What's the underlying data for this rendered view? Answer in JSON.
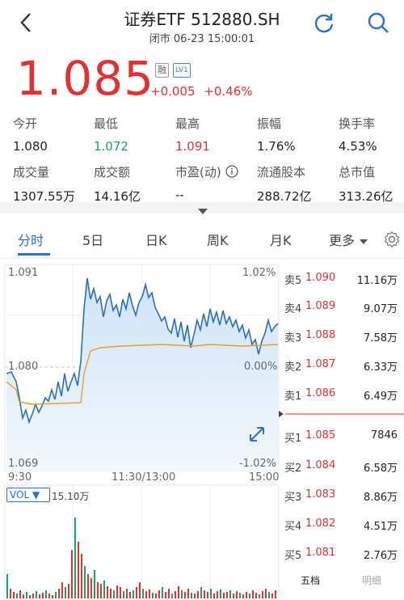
{
  "header": {
    "title": "证券ETF 512880.SH",
    "subtitle": "闭市 06-23 15:00:01"
  },
  "quote": {
    "price": "1.085",
    "tag_rong": "融",
    "tag_lv": "LV1",
    "change": "+0.005",
    "change_pct": "+0.46%"
  },
  "stats": {
    "open_label": "今开",
    "open": "1.080",
    "low_label": "最低",
    "low": "1.072",
    "high_label": "最高",
    "high": "1.091",
    "amplitude_label": "振幅",
    "amplitude": "1.76%",
    "turnover_rate_label": "换手率",
    "turnover_rate": "4.53%",
    "volume_label": "成交量",
    "volume": "1307.55万",
    "amount_label": "成交额",
    "amount": "14.16亿",
    "pe_label": "市盈(动)",
    "pe": "--",
    "float_label": "流通股本",
    "float": "288.72亿",
    "mktcap_label": "总市值",
    "mktcap": "313.26亿"
  },
  "tabs": {
    "intraday": "分时",
    "five_day": "5日",
    "day_k": "日K",
    "week_k": "周K",
    "month_k": "月K",
    "more": "更多"
  },
  "chart": {
    "y_top": "1.091",
    "y_mid": "1.080",
    "y_bot": "1.069",
    "pct_top": "1.02%",
    "pct_mid": "0.00%",
    "pct_bot": "-1.02%",
    "x_start": "9:30",
    "x_mid": "11:30/13:00",
    "x_end": "15:00",
    "vol_label": "VOL ▼",
    "vol_value": "15.10万"
  },
  "chart_data": {
    "type": "line",
    "x": [
      "9:30",
      "11:30/13:00",
      "15:00"
    ],
    "ylim": [
      1.069,
      1.091
    ],
    "prev_close": 1.08,
    "series": []
  },
  "order_book": {
    "asks": [
      {
        "name": "卖5",
        "price": "1.090",
        "vol": "11.16万"
      },
      {
        "name": "卖4",
        "price": "1.089",
        "vol": "9.07万"
      },
      {
        "name": "卖3",
        "price": "1.088",
        "vol": "7.58万"
      },
      {
        "name": "卖2",
        "price": "1.087",
        "vol": "6.33万"
      },
      {
        "name": "卖1",
        "price": "1.086",
        "vol": "6.49万"
      }
    ],
    "bids": [
      {
        "name": "买1",
        "price": "1.085",
        "vol": "7846"
      },
      {
        "name": "买2",
        "price": "1.084",
        "vol": "6.58万"
      },
      {
        "name": "买3",
        "price": "1.083",
        "vol": "8.86万"
      },
      {
        "name": "买4",
        "price": "1.082",
        "vol": "4.51万"
      },
      {
        "name": "买5",
        "price": "1.081",
        "vol": "2.76万"
      }
    ],
    "tab_five": "五档",
    "tab_detail": "明细"
  },
  "colors": {
    "up": "#e03232",
    "down": "#1aa260",
    "line": "#2a6fb8",
    "avg": "#e0a030",
    "accent": "#2f6fd0"
  }
}
